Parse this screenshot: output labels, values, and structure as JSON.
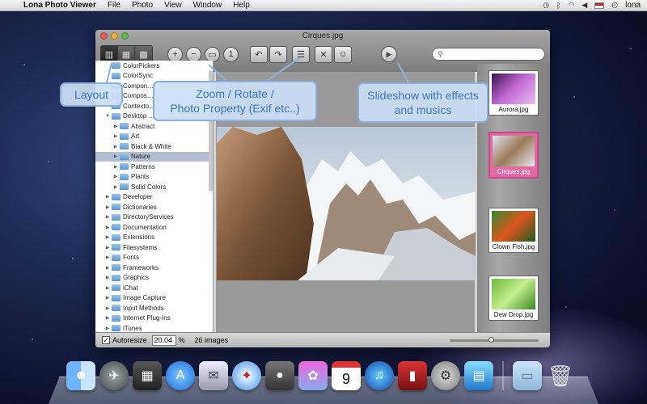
{
  "menubar": {
    "app_name": "Lona Photo Viewer",
    "menus": [
      "File",
      "Photo",
      "View",
      "Window",
      "Help"
    ],
    "user": "lona"
  },
  "window": {
    "title": "Cirques.jpg",
    "search_placeholder": ""
  },
  "callouts": {
    "layout": "Layout",
    "zoom": "Zoom / Rotate /\nPhoto Property (Exif etc..)",
    "slideshow": "Slideshow with effects\nand musics"
  },
  "tree": [
    {
      "label": "ColorPickers",
      "level": 1,
      "arrow": ""
    },
    {
      "label": "ColorSync",
      "level": 1,
      "arrow": ""
    },
    {
      "label": "Compon…",
      "level": 1,
      "arrow": ""
    },
    {
      "label": "Compos…",
      "level": 1,
      "arrow": ""
    },
    {
      "label": "Contexto…",
      "level": 1,
      "arrow": ""
    },
    {
      "label": "Desktop …",
      "level": 1,
      "arrow": "▼"
    },
    {
      "label": "Abstract",
      "level": 2,
      "arrow": "▶"
    },
    {
      "label": "Art",
      "level": 2,
      "arrow": "▶"
    },
    {
      "label": "Black & White",
      "level": 2,
      "arrow": "▶"
    },
    {
      "label": "Nature",
      "level": 2,
      "arrow": "▶",
      "selected": true
    },
    {
      "label": "Patterns",
      "level": 2,
      "arrow": "▶"
    },
    {
      "label": "Plants",
      "level": 2,
      "arrow": "▶"
    },
    {
      "label": "Solid Colors",
      "level": 2,
      "arrow": "▶"
    },
    {
      "label": "Developer",
      "level": 1,
      "arrow": "▶"
    },
    {
      "label": "Dictionaries",
      "level": 1,
      "arrow": "▶"
    },
    {
      "label": "DirectoryServices",
      "level": 1,
      "arrow": "▶"
    },
    {
      "label": "Documentation",
      "level": 1,
      "arrow": "▶"
    },
    {
      "label": "Extensions",
      "level": 1,
      "arrow": "▶"
    },
    {
      "label": "Filesystems",
      "level": 1,
      "arrow": "▶"
    },
    {
      "label": "Fonts",
      "level": 1,
      "arrow": "▶"
    },
    {
      "label": "Frameworks",
      "level": 1,
      "arrow": "▶"
    },
    {
      "label": "Graphics",
      "level": 1,
      "arrow": "▶"
    },
    {
      "label": "iChat",
      "level": 1,
      "arrow": "▶"
    },
    {
      "label": "Image Capture",
      "level": 1,
      "arrow": "▶"
    },
    {
      "label": "Input Methods",
      "level": 1,
      "arrow": "▶"
    },
    {
      "label": "Internet Plug-Ins",
      "level": 1,
      "arrow": "▶"
    },
    {
      "label": "iTunes",
      "level": 1,
      "arrow": "▶"
    }
  ],
  "thumbnails": [
    {
      "label": "Aurora.jpg",
      "colors": [
        "#3a1450",
        "#c56ad8",
        "#e8c0ef"
      ]
    },
    {
      "label": "Cirques.jpg",
      "colors": [
        "#dde6ee",
        "#9b7a5c",
        "#e5e9ec"
      ],
      "selected": true
    },
    {
      "label": "Clown Fish.jpg",
      "colors": [
        "#2f8a2e",
        "#e0561f",
        "#1a5b1c"
      ]
    },
    {
      "label": "Dew Drop.jpg",
      "colors": [
        "#6bbd3a",
        "#c6ec8f",
        "#3c8a20"
      ]
    }
  ],
  "statusbar": {
    "autoresize_label": "Autoresize",
    "zoom_value": "20.04",
    "zoom_unit": "%",
    "image_count": "26 images"
  },
  "dock": {
    "calendar_day": "9"
  },
  "colors": {
    "callout_text": "#3a76c8",
    "selected_thumb": "#e06aa2"
  }
}
